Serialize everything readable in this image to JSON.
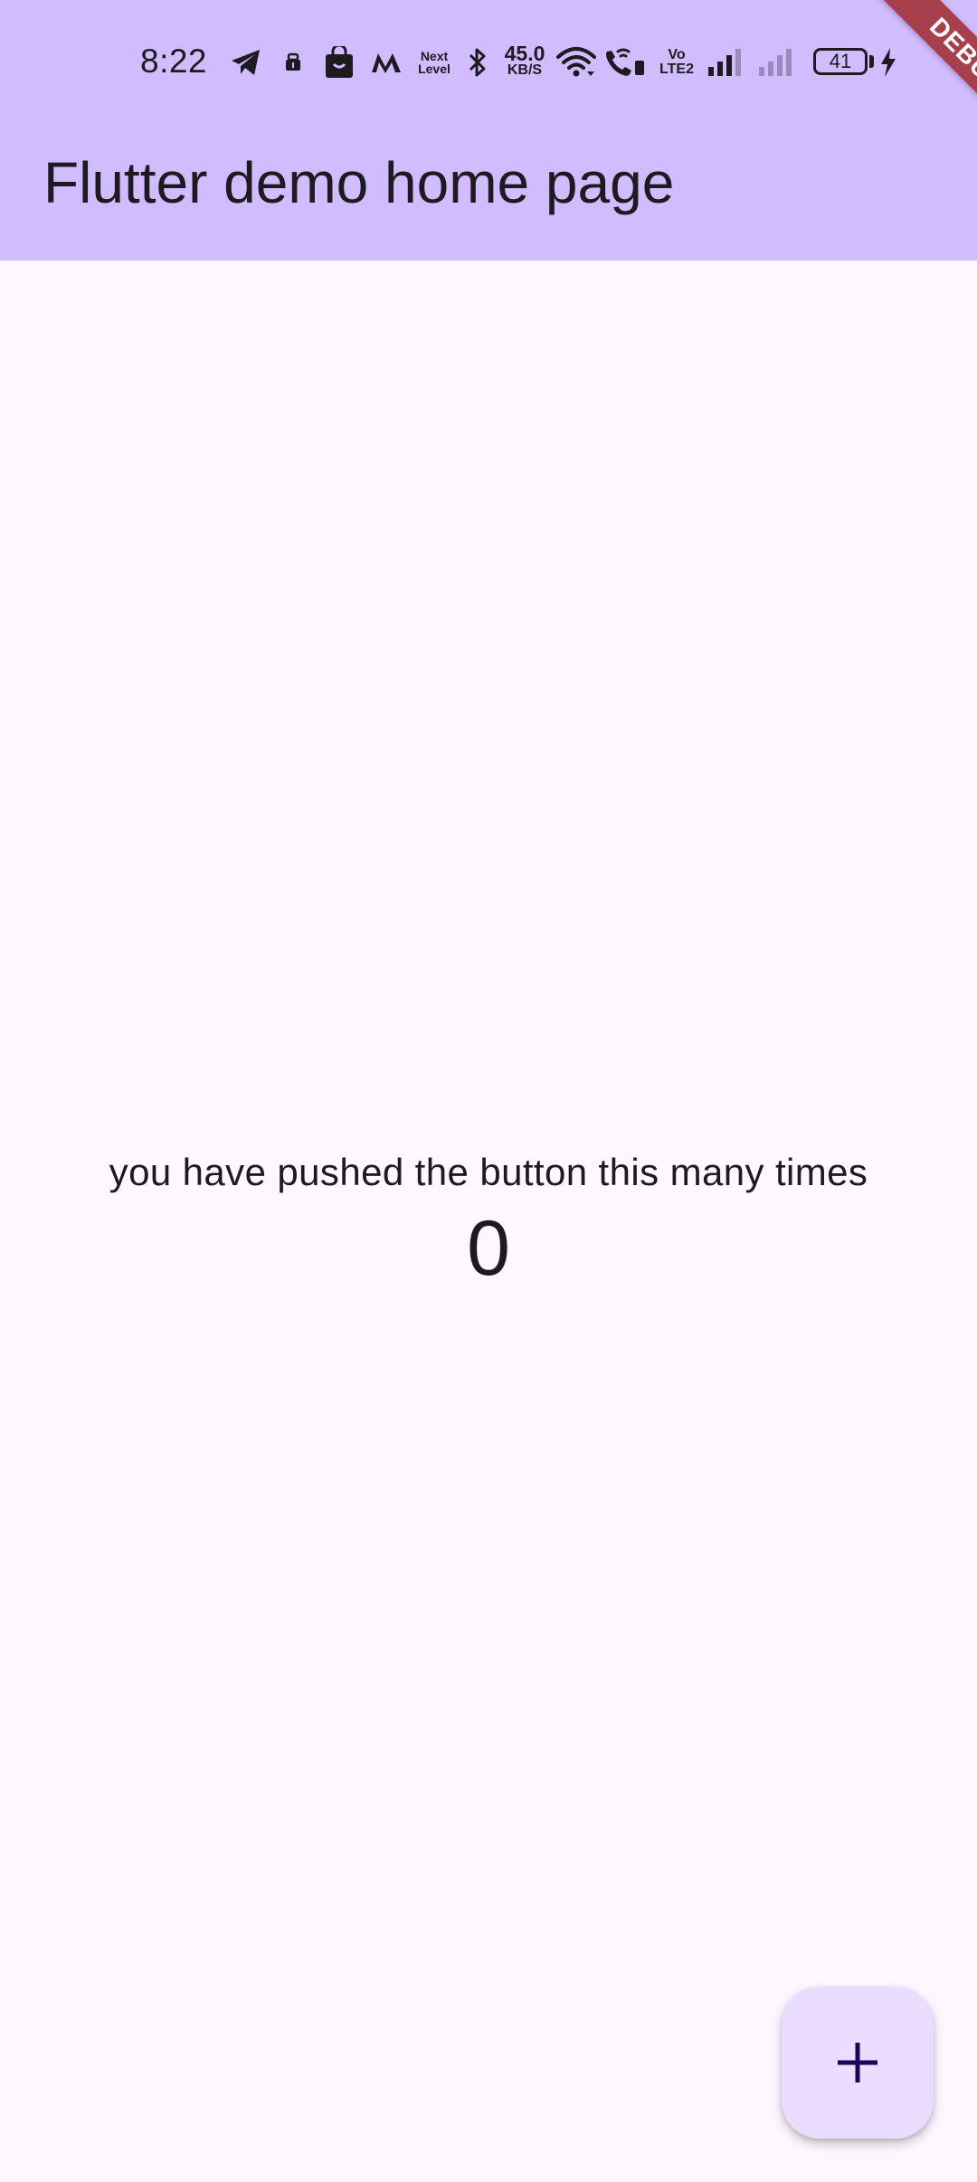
{
  "status_bar": {
    "time": "8:22",
    "next_level_line1": "Next",
    "next_level_line2": "Level",
    "speed_value": "45.0",
    "speed_unit": "KB/S",
    "volte_line1": "Vo",
    "volte_line2": "LTE2",
    "battery_level": "41",
    "icons": [
      "telegram-icon",
      "notification-icon",
      "shopping-bag-icon",
      "myntra-icon",
      "next-level-icon",
      "bluetooth-icon",
      "network-speed-icon",
      "wifi-icon",
      "wifi-calling-icon",
      "volte-icon",
      "signal-1-icon",
      "signal-2-icon",
      "battery-icon",
      "charging-icon"
    ]
  },
  "app_bar": {
    "title": "Flutter demo home page",
    "background_color": "#d1bcff"
  },
  "debug_banner": {
    "label": "DEBUG",
    "color": "#a83f4c"
  },
  "body": {
    "counter_label": "you have pushed the button this many times",
    "counter_value": "0",
    "background_color": "#fef7ff"
  },
  "fab": {
    "icon": "plus-icon",
    "background_color": "#eaddff"
  }
}
